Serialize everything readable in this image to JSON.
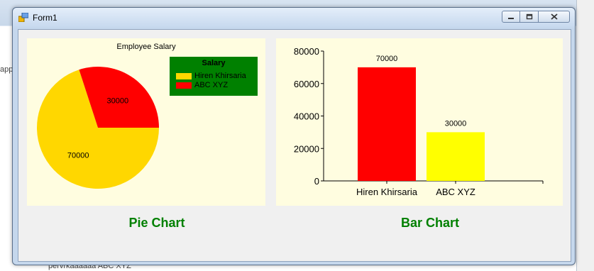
{
  "window": {
    "title": "Form1"
  },
  "background": {
    "bottom_text": "pervrkaaaaaa     ABC XYZ",
    "left_text": "app"
  },
  "pie_panel": {
    "title": "Employee Salary",
    "legend": {
      "title": "Salary",
      "items": [
        {
          "label": "Hiren Khirsaria",
          "color": "#ffd700"
        },
        {
          "label": "ABC XYZ",
          "color": "#ff0000"
        }
      ]
    },
    "caption": "Pie Chart"
  },
  "bar_panel": {
    "caption": "Bar Chart"
  },
  "colors": {
    "caption": "#008000",
    "panel_bg": "#fffde0",
    "legend_bg": "#008000"
  },
  "chart_data": [
    {
      "type": "pie",
      "title": "Employee Salary",
      "categories": [
        "Hiren Khirsaria",
        "ABC XYZ"
      ],
      "values": [
        70000,
        30000
      ],
      "colors": [
        "#ffd700",
        "#ff0000"
      ],
      "data_labels": [
        "70000",
        "30000"
      ],
      "legend": "top-right"
    },
    {
      "type": "bar",
      "categories": [
        "Hiren Khirsaria",
        "ABC XYZ"
      ],
      "values": [
        70000,
        30000
      ],
      "colors": [
        "#ff0000",
        "#ffff00"
      ],
      "data_labels": [
        "70000",
        "30000"
      ],
      "ylim": [
        0,
        80000
      ],
      "yticks": [
        "0",
        "20000",
        "40000",
        "60000",
        "80000"
      ],
      "grid": false
    }
  ]
}
